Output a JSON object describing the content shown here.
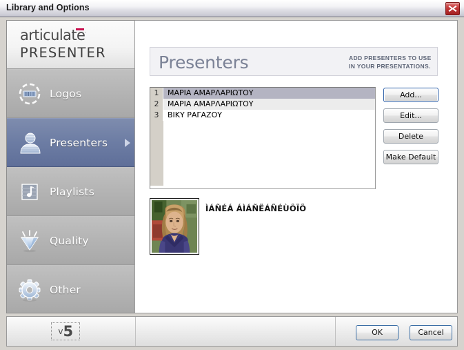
{
  "window": {
    "title": "Library and Options",
    "close_icon": "close-x-icon"
  },
  "sidebar": {
    "brand": {
      "line1": "articulate",
      "line2": "PRESENTER",
      "registered_mark": "·",
      "accent_color": "#c8104e"
    },
    "items": [
      {
        "label": "Logos",
        "icon": "logo-badge-icon",
        "selected": false
      },
      {
        "label": "Presenters",
        "icon": "person-icon",
        "selected": true
      },
      {
        "label": "Playlists",
        "icon": "music-note-icon",
        "selected": false
      },
      {
        "label": "Quality",
        "icon": "diamond-icon",
        "selected": false
      },
      {
        "label": "Other",
        "icon": "gear-icon",
        "selected": false
      }
    ],
    "selected_arrow_icon": "chevron-right-icon"
  },
  "main": {
    "header": {
      "title": "Presenters",
      "subtitle": "ADD PRESENTERS TO USE IN YOUR PRESENTATIONS.",
      "title_color": "#7b8296"
    },
    "list": {
      "rows": [
        {
          "num": "1",
          "name": "ΜΑΡΙΑ ΑΜΑΡΛΑΡΙΩΤΟΥ",
          "state": "selected"
        },
        {
          "num": "2",
          "name": "ΜΑΡΙΑ ΑΜΑΡΛΑΡΙΩΤΟΥ",
          "state": "alternate"
        },
        {
          "num": "3",
          "name": "ΒΙΚΥ ΡΑΓΑΖΟΥ",
          "state": "plain"
        }
      ],
      "selected_row_color": "#b4b4c2",
      "alternate_row_color": "#ececec"
    },
    "buttons": [
      {
        "label": "Add...",
        "default": true
      },
      {
        "label": "Edit...",
        "default": false
      },
      {
        "label": "Delete",
        "default": false
      },
      {
        "label": "Make Default",
        "default": false
      }
    ],
    "detail": {
      "photo_alt": "presenter-photo",
      "name": "ÌÁÑÉÁ ÁÌÁÑËÁÑÉÙÔÏÕ"
    }
  },
  "footer": {
    "version_prefix": "v",
    "version_number": "5",
    "ok_label": "OK",
    "cancel_label": "Cancel"
  }
}
